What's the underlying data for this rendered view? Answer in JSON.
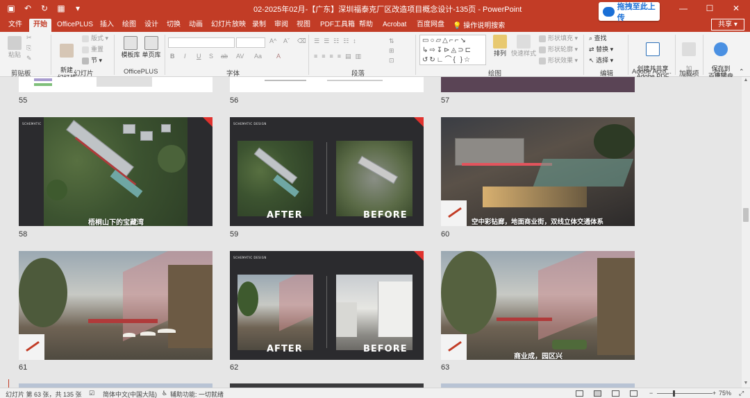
{
  "app": {
    "window_title": "02-2025年02月-【广东】深圳福泰克厂区改造项目概念设计-135页  -  PowerPoint",
    "upload_button": "拖拽至此上传",
    "share_button": "共享"
  },
  "tabs": [
    "文件",
    "开始",
    "OfficePLUS",
    "插入",
    "绘图",
    "设计",
    "切换",
    "动画",
    "幻灯片放映",
    "录制",
    "审阅",
    "视图",
    "PDF工具箱",
    "帮助",
    "Acrobat",
    "百度网盘"
  ],
  "active_tab": "开始",
  "tell_me": "操作说明搜索",
  "ribbon": {
    "clipboard": {
      "label": "剪贴板",
      "paste": "粘贴"
    },
    "slides": {
      "label": "幻灯片",
      "new_slide": "新建\n幻灯片",
      "layout": "版式",
      "reset": "重置",
      "section": "节"
    },
    "officeplus": {
      "label": "OfficePLUS",
      "template": "模板库",
      "single_page": "单页库"
    },
    "font": {
      "label": "字体",
      "font_buttons": [
        "B",
        "I",
        "U",
        "S",
        "ab",
        "AV",
        "Aa",
        "A"
      ]
    },
    "paragraph": {
      "label": "段落"
    },
    "drawing": {
      "label": "绘图",
      "arrange": "排列",
      "quick_styles": "快速样式",
      "fill": "形状填充",
      "outline": "形状轮廓",
      "effects": "形状效果"
    },
    "editing": {
      "label": "编辑",
      "find": "查找",
      "replace": "替换",
      "select": "选择"
    },
    "adobe": {
      "label": "Adobe Acro...",
      "create_share": "创建并共享\nAdobe PDF"
    },
    "addins": {
      "label": "加载项",
      "addin": "加\n载项"
    },
    "save": {
      "label": "保存",
      "save_baidu": "保存到\n百度网盘"
    }
  },
  "slides": [
    {
      "num": "55"
    },
    {
      "num": "56"
    },
    {
      "num": "57"
    },
    {
      "num": "58",
      "caption": "梧桐山下的宝藏湾"
    },
    {
      "num": "59",
      "after": "AFTER",
      "before": "BEFORE"
    },
    {
      "num": "60",
      "caption": "空中彩钻廊，地面商业街，双线立体交通体系"
    },
    {
      "num": "61"
    },
    {
      "num": "62",
      "after": "AFTER",
      "before": "BEFORE"
    },
    {
      "num": "63",
      "caption": "商业成，园区兴"
    }
  ],
  "statusbar": {
    "slide_info": "幻灯片 第 63 张，共 135 张",
    "language": "简体中文(中国大陆)",
    "accessibility": "辅助功能: 一切就绪",
    "zoom": "75%"
  },
  "colors": {
    "accent": "#c23c26",
    "background": "#e6e6e6"
  }
}
